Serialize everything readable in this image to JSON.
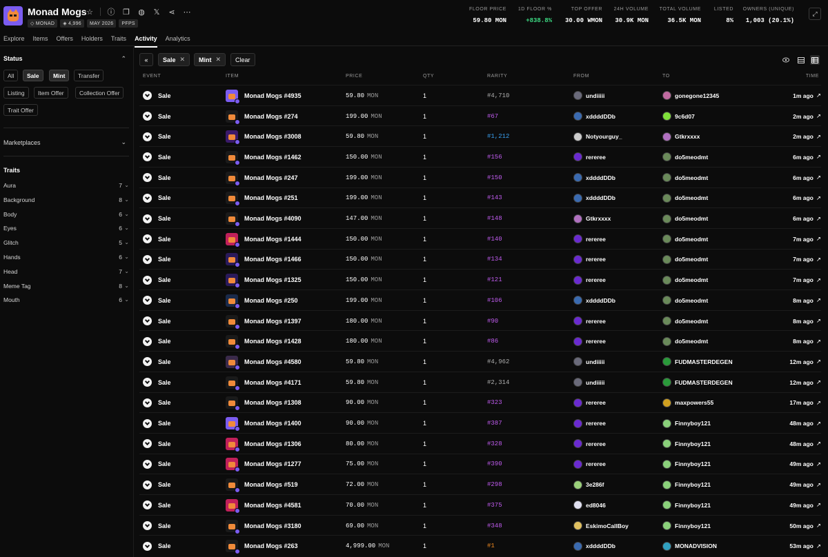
{
  "collection": {
    "title": "Monad Mogs",
    "chips": [
      {
        "icon": "diamond-icon",
        "label": "MONAD"
      },
      {
        "icon": "stack-icon",
        "label": "4,996"
      },
      {
        "icon": "",
        "label": "MAY 2026"
      },
      {
        "icon": "",
        "label": "PFPS"
      }
    ],
    "header_icons": [
      "star-icon",
      "info-icon",
      "copy-icon",
      "globe-icon",
      "x-logo-icon",
      "share-icon",
      "more-icon"
    ]
  },
  "stats": [
    {
      "label": "FLOOR PRICE",
      "value": "59.80 MON",
      "color": ""
    },
    {
      "label": "1D FLOOR %",
      "value": "+838.8%",
      "color": "green"
    },
    {
      "label": "TOP OFFER",
      "value": "30.00 WMON",
      "color": ""
    },
    {
      "label": "24H VOLUME",
      "value": "30.9K MON",
      "color": ""
    },
    {
      "label": "TOTAL VOLUME",
      "value": "36.5K MON",
      "color": ""
    },
    {
      "label": "LISTED",
      "value": "8%",
      "color": ""
    },
    {
      "label": "OWNERS (UNIQUE)",
      "value": "1,003 (20.1%)",
      "color": ""
    }
  ],
  "nav": {
    "tabs": [
      "Explore",
      "Items",
      "Offers",
      "Holders",
      "Traits",
      "Activity",
      "Analytics"
    ],
    "active": "Activity"
  },
  "sidebar": {
    "status_title": "Status",
    "status_filters": [
      {
        "label": "All",
        "selected": false
      },
      {
        "label": "Sale",
        "selected": true
      },
      {
        "label": "Mint",
        "selected": true
      },
      {
        "label": "Transfer",
        "selected": false
      },
      {
        "label": "Listing",
        "selected": false
      },
      {
        "label": "Item Offer",
        "selected": false
      },
      {
        "label": "Collection Offer",
        "selected": false
      },
      {
        "label": "Trait Offer",
        "selected": false
      }
    ],
    "marketplaces_title": "Marketplaces",
    "traits_title": "Traits",
    "traits": [
      {
        "name": "Aura",
        "count": "7"
      },
      {
        "name": "Background",
        "count": "8"
      },
      {
        "name": "Body",
        "count": "6"
      },
      {
        "name": "Eyes",
        "count": "6"
      },
      {
        "name": "Glitch",
        "count": "5"
      },
      {
        "name": "Hands",
        "count": "6"
      },
      {
        "name": "Head",
        "count": "7"
      },
      {
        "name": "Meme Tag",
        "count": "8"
      },
      {
        "name": "Mouth",
        "count": "6"
      }
    ]
  },
  "toolbar": {
    "collapse_icon": "double-chevron-left-icon",
    "active_filters": [
      "Sale",
      "Mint"
    ],
    "clear_label": "Clear"
  },
  "table": {
    "headers": [
      "EVENT",
      "ITEM",
      "PRICE",
      "QTY",
      "RARITY",
      "FROM",
      "TO",
      "TIME"
    ],
    "rows": [
      {
        "event": "Sale",
        "item": "Monad Mogs #4935",
        "price": "59.80",
        "currency": "MON",
        "qty": "1",
        "rarity": "#4,710",
        "rarity_color": "#b0b0b0",
        "from": "undiiiii",
        "from_color": "#6a6a7a",
        "to": "gonegone12345",
        "to_color": "#c06aa0",
        "time": "1m ago",
        "thumb_bg": "#7b5cf0"
      },
      {
        "event": "Sale",
        "item": "Monad Mogs #274",
        "price": "199.00",
        "currency": "MON",
        "qty": "1",
        "rarity": "#67",
        "rarity_color": "#c15cf0",
        "from": "xddddDDb",
        "from_color": "#3a6ab0",
        "to": "9c6d07",
        "to_color": "#7fe03a",
        "time": "2m ago",
        "thumb_bg": "#1a1a1a"
      },
      {
        "event": "Sale",
        "item": "Monad Mogs #3008",
        "price": "59.80",
        "currency": "MON",
        "qty": "1",
        "rarity": "#1,212",
        "rarity_color": "#3aa0f0",
        "from": "Notyourguy_",
        "from_color": "#cccccc",
        "to": "Gtkrxxxx",
        "to_color": "#b070c0",
        "time": "2m ago",
        "thumb_bg": "#3a1a6a"
      },
      {
        "event": "Sale",
        "item": "Monad Mogs #1462",
        "price": "150.00",
        "currency": "MON",
        "qty": "1",
        "rarity": "#156",
        "rarity_color": "#c15cf0",
        "from": "rereree",
        "from_color": "#6a2ad0",
        "to": "do5meodmt",
        "to_color": "#6a8a5a",
        "time": "6m ago",
        "thumb_bg": "#1a1a1a"
      },
      {
        "event": "Sale",
        "item": "Monad Mogs #247",
        "price": "199.00",
        "currency": "MON",
        "qty": "1",
        "rarity": "#150",
        "rarity_color": "#c15cf0",
        "from": "xddddDDb",
        "from_color": "#3a6ab0",
        "to": "do5meodmt",
        "to_color": "#6a8a5a",
        "time": "6m ago",
        "thumb_bg": "#1a1a1a"
      },
      {
        "event": "Sale",
        "item": "Monad Mogs #251",
        "price": "199.00",
        "currency": "MON",
        "qty": "1",
        "rarity": "#143",
        "rarity_color": "#c15cf0",
        "from": "xddddDDb",
        "from_color": "#3a6ab0",
        "to": "do5meodmt",
        "to_color": "#6a8a5a",
        "time": "6m ago",
        "thumb_bg": "#1a1a1a"
      },
      {
        "event": "Sale",
        "item": "Monad Mogs #4090",
        "price": "147.00",
        "currency": "MON",
        "qty": "1",
        "rarity": "#148",
        "rarity_color": "#c15cf0",
        "from": "Gtkrxxxx",
        "from_color": "#b070c0",
        "to": "do5meodmt",
        "to_color": "#6a8a5a",
        "time": "6m ago",
        "thumb_bg": "#1a1a1a"
      },
      {
        "event": "Sale",
        "item": "Monad Mogs #1444",
        "price": "150.00",
        "currency": "MON",
        "qty": "1",
        "rarity": "#140",
        "rarity_color": "#c15cf0",
        "from": "rereree",
        "from_color": "#6a2ad0",
        "to": "do5meodmt",
        "to_color": "#6a8a5a",
        "time": "7m ago",
        "thumb_bg": "#c0205a"
      },
      {
        "event": "Sale",
        "item": "Monad Mogs #1466",
        "price": "150.00",
        "currency": "MON",
        "qty": "1",
        "rarity": "#134",
        "rarity_color": "#c15cf0",
        "from": "rereree",
        "from_color": "#6a2ad0",
        "to": "do5meodmt",
        "to_color": "#6a8a5a",
        "time": "7m ago",
        "thumb_bg": "#2a1a5a"
      },
      {
        "event": "Sale",
        "item": "Monad Mogs #1325",
        "price": "150.00",
        "currency": "MON",
        "qty": "1",
        "rarity": "#121",
        "rarity_color": "#c15cf0",
        "from": "rereree",
        "from_color": "#6a2ad0",
        "to": "do5meodmt",
        "to_color": "#6a8a5a",
        "time": "7m ago",
        "thumb_bg": "#2a1a5a"
      },
      {
        "event": "Sale",
        "item": "Monad Mogs #250",
        "price": "199.00",
        "currency": "MON",
        "qty": "1",
        "rarity": "#106",
        "rarity_color": "#c15cf0",
        "from": "xddddDDb",
        "from_color": "#3a6ab0",
        "to": "do5meodmt",
        "to_color": "#6a8a5a",
        "time": "8m ago",
        "thumb_bg": "#1a2a4a"
      },
      {
        "event": "Sale",
        "item": "Monad Mogs #1397",
        "price": "180.00",
        "currency": "MON",
        "qty": "1",
        "rarity": "#90",
        "rarity_color": "#c15cf0",
        "from": "rereree",
        "from_color": "#6a2ad0",
        "to": "do5meodmt",
        "to_color": "#6a8a5a",
        "time": "8m ago",
        "thumb_bg": "#1a1a1a"
      },
      {
        "event": "Sale",
        "item": "Monad Mogs #1428",
        "price": "180.00",
        "currency": "MON",
        "qty": "1",
        "rarity": "#86",
        "rarity_color": "#c15cf0",
        "from": "rereree",
        "from_color": "#6a2ad0",
        "to": "do5meodmt",
        "to_color": "#6a8a5a",
        "time": "8m ago",
        "thumb_bg": "#1a1a1a"
      },
      {
        "event": "Sale",
        "item": "Monad Mogs #4580",
        "price": "59.80",
        "currency": "MON",
        "qty": "1",
        "rarity": "#4,962",
        "rarity_color": "#b0b0b0",
        "from": "undiiiii",
        "from_color": "#6a6a7a",
        "to": "FUDMASTERDEGEN",
        "to_color": "#2a9a3a",
        "time": "12m ago",
        "thumb_bg": "#3a2a4a"
      },
      {
        "event": "Sale",
        "item": "Monad Mogs #4171",
        "price": "59.80",
        "currency": "MON",
        "qty": "1",
        "rarity": "#2,314",
        "rarity_color": "#b0b0b0",
        "from": "undiiiii",
        "from_color": "#6a6a7a",
        "to": "FUDMASTERDEGEN",
        "to_color": "#2a9a3a",
        "time": "12m ago",
        "thumb_bg": "#1a1a1a"
      },
      {
        "event": "Sale",
        "item": "Monad Mogs #1308",
        "price": "90.00",
        "currency": "MON",
        "qty": "1",
        "rarity": "#323",
        "rarity_color": "#c15cf0",
        "from": "rereree",
        "from_color": "#6a2ad0",
        "to": "maxpowers55",
        "to_color": "#d0a020",
        "time": "17m ago",
        "thumb_bg": "#1a1a1a"
      },
      {
        "event": "Sale",
        "item": "Monad Mogs #1400",
        "price": "90.00",
        "currency": "MON",
        "qty": "1",
        "rarity": "#387",
        "rarity_color": "#c15cf0",
        "from": "rereree",
        "from_color": "#6a2ad0",
        "to": "Finnyboy121",
        "to_color": "#8ad07a",
        "time": "48m ago",
        "thumb_bg": "#7b5cf0"
      },
      {
        "event": "Sale",
        "item": "Monad Mogs #1306",
        "price": "80.00",
        "currency": "MON",
        "qty": "1",
        "rarity": "#328",
        "rarity_color": "#c15cf0",
        "from": "rereree",
        "from_color": "#6a2ad0",
        "to": "Finnyboy121",
        "to_color": "#8ad07a",
        "time": "48m ago",
        "thumb_bg": "#c0205a"
      },
      {
        "event": "Sale",
        "item": "Monad Mogs #1277",
        "price": "75.00",
        "currency": "MON",
        "qty": "1",
        "rarity": "#390",
        "rarity_color": "#c15cf0",
        "from": "rereree",
        "from_color": "#6a2ad0",
        "to": "Finnyboy121",
        "to_color": "#8ad07a",
        "time": "49m ago",
        "thumb_bg": "#c0205a"
      },
      {
        "event": "Sale",
        "item": "Monad Mogs #519",
        "price": "72.00",
        "currency": "MON",
        "qty": "1",
        "rarity": "#298",
        "rarity_color": "#c15cf0",
        "from": "3e286f",
        "from_color": "#9ad07a",
        "to": "Finnyboy121",
        "to_color": "#8ad07a",
        "time": "49m ago",
        "thumb_bg": "#1a1a1a"
      },
      {
        "event": "Sale",
        "item": "Monad Mogs #4581",
        "price": "70.00",
        "currency": "MON",
        "qty": "1",
        "rarity": "#375",
        "rarity_color": "#c15cf0",
        "from": "ed8046",
        "from_color": "#e0e0f0",
        "to": "Finnyboy121",
        "to_color": "#8ad07a",
        "time": "49m ago",
        "thumb_bg": "#c0205a"
      },
      {
        "event": "Sale",
        "item": "Monad Mogs #3180",
        "price": "69.00",
        "currency": "MON",
        "qty": "1",
        "rarity": "#348",
        "rarity_color": "#c15cf0",
        "from": "EskimoCallBoy",
        "from_color": "#e0c060",
        "to": "Finnyboy121",
        "to_color": "#8ad07a",
        "time": "50m ago",
        "thumb_bg": "#1a1a1a"
      },
      {
        "event": "Sale",
        "item": "Monad Mogs #263",
        "price": "4,999.00",
        "currency": "MON",
        "qty": "1",
        "rarity": "#1",
        "rarity_color": "#f08a20",
        "from": "xddddDDb",
        "from_color": "#3a6ab0",
        "to": "MONADVISION",
        "to_color": "#30a0c0",
        "time": "53m ago",
        "thumb_bg": "#1a1a1a"
      }
    ]
  }
}
